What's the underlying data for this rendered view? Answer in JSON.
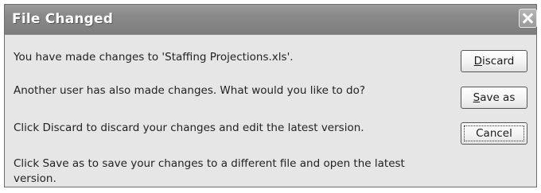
{
  "dialog": {
    "title": "File Changed",
    "messages": [
      "You have made changes to 'Staffing Projections.xls'.",
      "Another user has also made changes. What would you like to do?",
      "Click Discard to discard your changes and edit the latest version.",
      "Click Save as to save your changes to a different file and open the latest",
      "version."
    ],
    "buttons": {
      "discard": {
        "mnemonic": "D",
        "rest": "iscard"
      },
      "save_as": {
        "mnemonic": "S",
        "rest": "ave as"
      },
      "cancel": {
        "label": "Cancel"
      }
    },
    "close_icon": "close-icon",
    "colors": {
      "title_bar": "#8a8a8a",
      "title_text": "#ffffff",
      "dialog_background": "#e6e6e6"
    }
  }
}
